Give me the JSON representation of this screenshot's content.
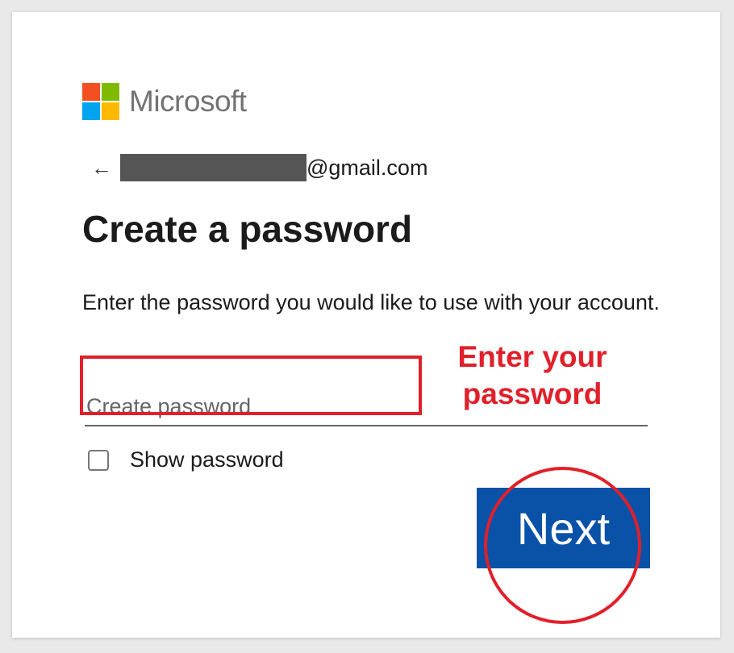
{
  "brand": {
    "name": "Microsoft",
    "colors": [
      "#f25022",
      "#7fba00",
      "#00a4ef",
      "#ffb900"
    ]
  },
  "identity": {
    "back_icon": "arrow-left-icon",
    "email_suffix": "@gmail.com"
  },
  "title": "Create a password",
  "description": "Enter the password you would like to use with your account.",
  "password_field": {
    "placeholder": "Create password",
    "value": ""
  },
  "show_password": {
    "label": "Show password",
    "checked": false
  },
  "next_button": {
    "label": "Next",
    "color": "#0a51a8"
  },
  "annotation": {
    "text": "Enter your\npassword",
    "color": "#e0202a"
  }
}
